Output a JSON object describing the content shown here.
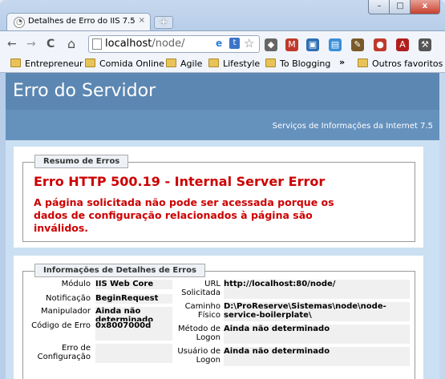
{
  "browser": {
    "tab_title": "Detalhes de Erro do IIS 7.5",
    "tab_close": "×",
    "new_tab": "+",
    "window_buttons": {
      "minimize": "–",
      "maximize": "□",
      "close": "x"
    },
    "address": {
      "host": "localhost",
      "path": "/node/"
    },
    "nav": {
      "back": "←",
      "forward": "→",
      "reload": "C",
      "home": "⌂"
    },
    "extensions": [
      {
        "name": "ie-tab-icon",
        "glyph": "e"
      },
      {
        "name": "tumblr-icon",
        "glyph": "t"
      },
      {
        "name": "bookmark-star-icon",
        "glyph": "☆"
      }
    ],
    "toolbar_icons": [
      {
        "name": "extension-dog-icon",
        "glyph": "◆",
        "color": "#666666"
      },
      {
        "name": "gmail-icon",
        "glyph": "M",
        "color": "#c0392b"
      },
      {
        "name": "monitor-icon",
        "glyph": "▣",
        "color": "#2f6eb5"
      },
      {
        "name": "document-icon",
        "glyph": "▤",
        "color": "#3a8fd8"
      },
      {
        "name": "pen-icon",
        "glyph": "✎",
        "color": "#7a5a2a"
      },
      {
        "name": "lastpass-icon",
        "glyph": "●",
        "color": "#c0392b"
      },
      {
        "name": "acrobat-icon",
        "glyph": "A",
        "color": "#b01e1e"
      },
      {
        "name": "wrench-icon",
        "glyph": "⚒",
        "color": "#555555"
      }
    ],
    "bookmarks": [
      "Entrepreneur",
      "Comida Online",
      "Agile",
      "Lifestyle",
      "To Blogging"
    ],
    "bookmarks_more": "»",
    "other_bookmarks": "Outros favoritos"
  },
  "page": {
    "title": "Erro do Servidor",
    "subtitle": "Serviços de Informações da Internet 7.5",
    "summary": {
      "legend": "Resumo de Erros",
      "error_title": "Erro HTTP 500.19 - Internal Server Error",
      "error_description": "A página solicitada não pode ser acessada porque os dados de configuração relacionados à página são inválidos."
    },
    "details": {
      "legend": "Informações de Detalhes de Erros",
      "left": [
        {
          "label": "Módulo",
          "value": "IIS Web Core"
        },
        {
          "label": "Notificação",
          "value": "BeginRequest"
        },
        {
          "label": "Manipulador",
          "value": "Ainda não determinado"
        },
        {
          "label": "Código de Erro",
          "value": "0x8007000d"
        },
        {
          "label": "Erro de Configuração",
          "value": ""
        }
      ],
      "right": [
        {
          "label": "URL Solicitada",
          "value": "http://localhost:80/node/"
        },
        {
          "label": "Caminho Físico",
          "value": "D:\\ProReserve\\Sistemas\\node\\node-service-boilerplate\\"
        },
        {
          "label": "Método de Logon",
          "value": "Ainda não determinado"
        },
        {
          "label": "Usuário de Logon",
          "value": "Ainda não determinado"
        }
      ]
    }
  }
}
